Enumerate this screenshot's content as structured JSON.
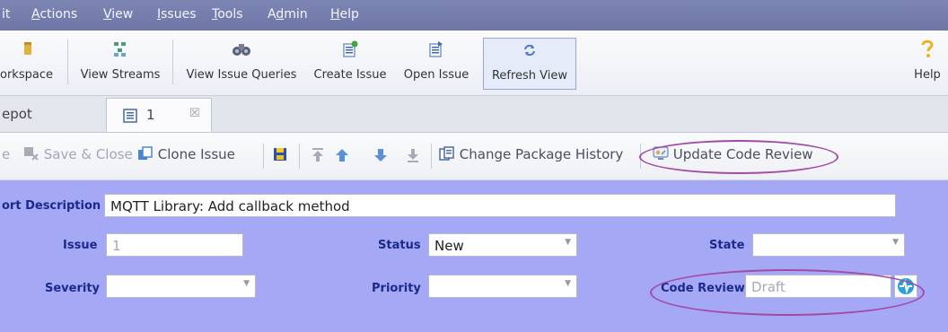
{
  "menu": {
    "items": [
      {
        "pre": "it",
        "u": "",
        "post": ""
      },
      {
        "pre": "",
        "u": "A",
        "post": "ctions"
      },
      {
        "pre": "",
        "u": "V",
        "post": "iew"
      },
      {
        "pre": "",
        "u": "I",
        "post": "ssues"
      },
      {
        "pre": "",
        "u": "T",
        "post": "ools"
      },
      {
        "pre": "A",
        "u": "d",
        "post": "min"
      },
      {
        "pre": "",
        "u": "H",
        "post": "elp"
      }
    ]
  },
  "toolbar": {
    "workspace_label": "orkspace",
    "view_streams_label": "View Streams",
    "view_issue_queries_label": "View Issue Queries",
    "create_issue_label": "Create Issue",
    "open_issue_label": "Open Issue",
    "refresh_view_label": "Refresh View",
    "help_label": "Help"
  },
  "tabs": {
    "depot_label": "epot",
    "issue_tab_label": "1",
    "close_glyph": "☒"
  },
  "actions": {
    "save_partial": "e",
    "save_close_label": "Save & Close",
    "clone_issue_label": "Clone Issue",
    "change_package_history_label": "Change Package History",
    "update_code_review_label": "Update Code Review"
  },
  "form": {
    "short_description_label": "ort Description",
    "short_description_value": "MQTT Library: Add callback method",
    "issue_label": "Issue",
    "issue_value": "1",
    "status_label": "Status",
    "status_value": "New",
    "state_label": "State",
    "state_value": "",
    "severity_label": "Severity",
    "severity_value": "",
    "priority_label": "Priority",
    "priority_value": "",
    "code_review_label": "Code Review",
    "code_review_value": "Draft"
  },
  "colors": {
    "menu_bg": "#747dad",
    "form_bg": "#a5a8f5",
    "label_text": "#1a2a8a",
    "annotation_oval": "#a24aa6"
  }
}
